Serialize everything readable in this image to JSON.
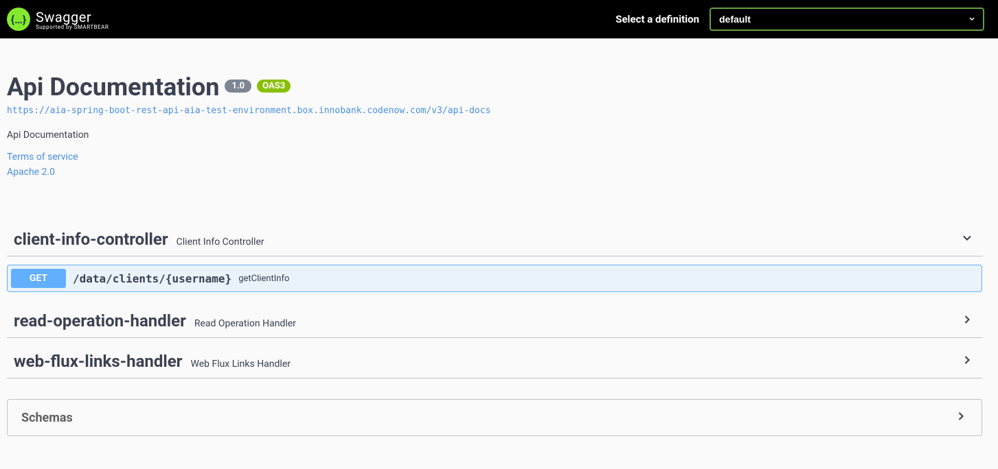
{
  "header": {
    "brand_name": "Swagger",
    "brand_sub": "Supported by SMARTBEAR",
    "selector_label": "Select a definition",
    "selected_definition": "default"
  },
  "info": {
    "title": "Api Documentation",
    "version": "1.0",
    "oas": "OAS3",
    "url": "https://aia-spring-boot-rest-api-aia-test-environment.box.innobank.codenow.com/v3/api-docs",
    "description": "Api Documentation",
    "terms_label": "Terms of service",
    "license_label": "Apache 2.0"
  },
  "tags": [
    {
      "name": "client-info-controller",
      "description": "Client Info Controller",
      "expanded": true
    },
    {
      "name": "read-operation-handler",
      "description": "Read Operation Handler",
      "expanded": false
    },
    {
      "name": "web-flux-links-handler",
      "description": "Web Flux Links Handler",
      "expanded": false
    }
  ],
  "operations": {
    "client_info": {
      "method": "GET",
      "path": "/data/clients/{username}",
      "summary": "getClientInfo"
    }
  },
  "schemas": {
    "title": "Schemas"
  }
}
